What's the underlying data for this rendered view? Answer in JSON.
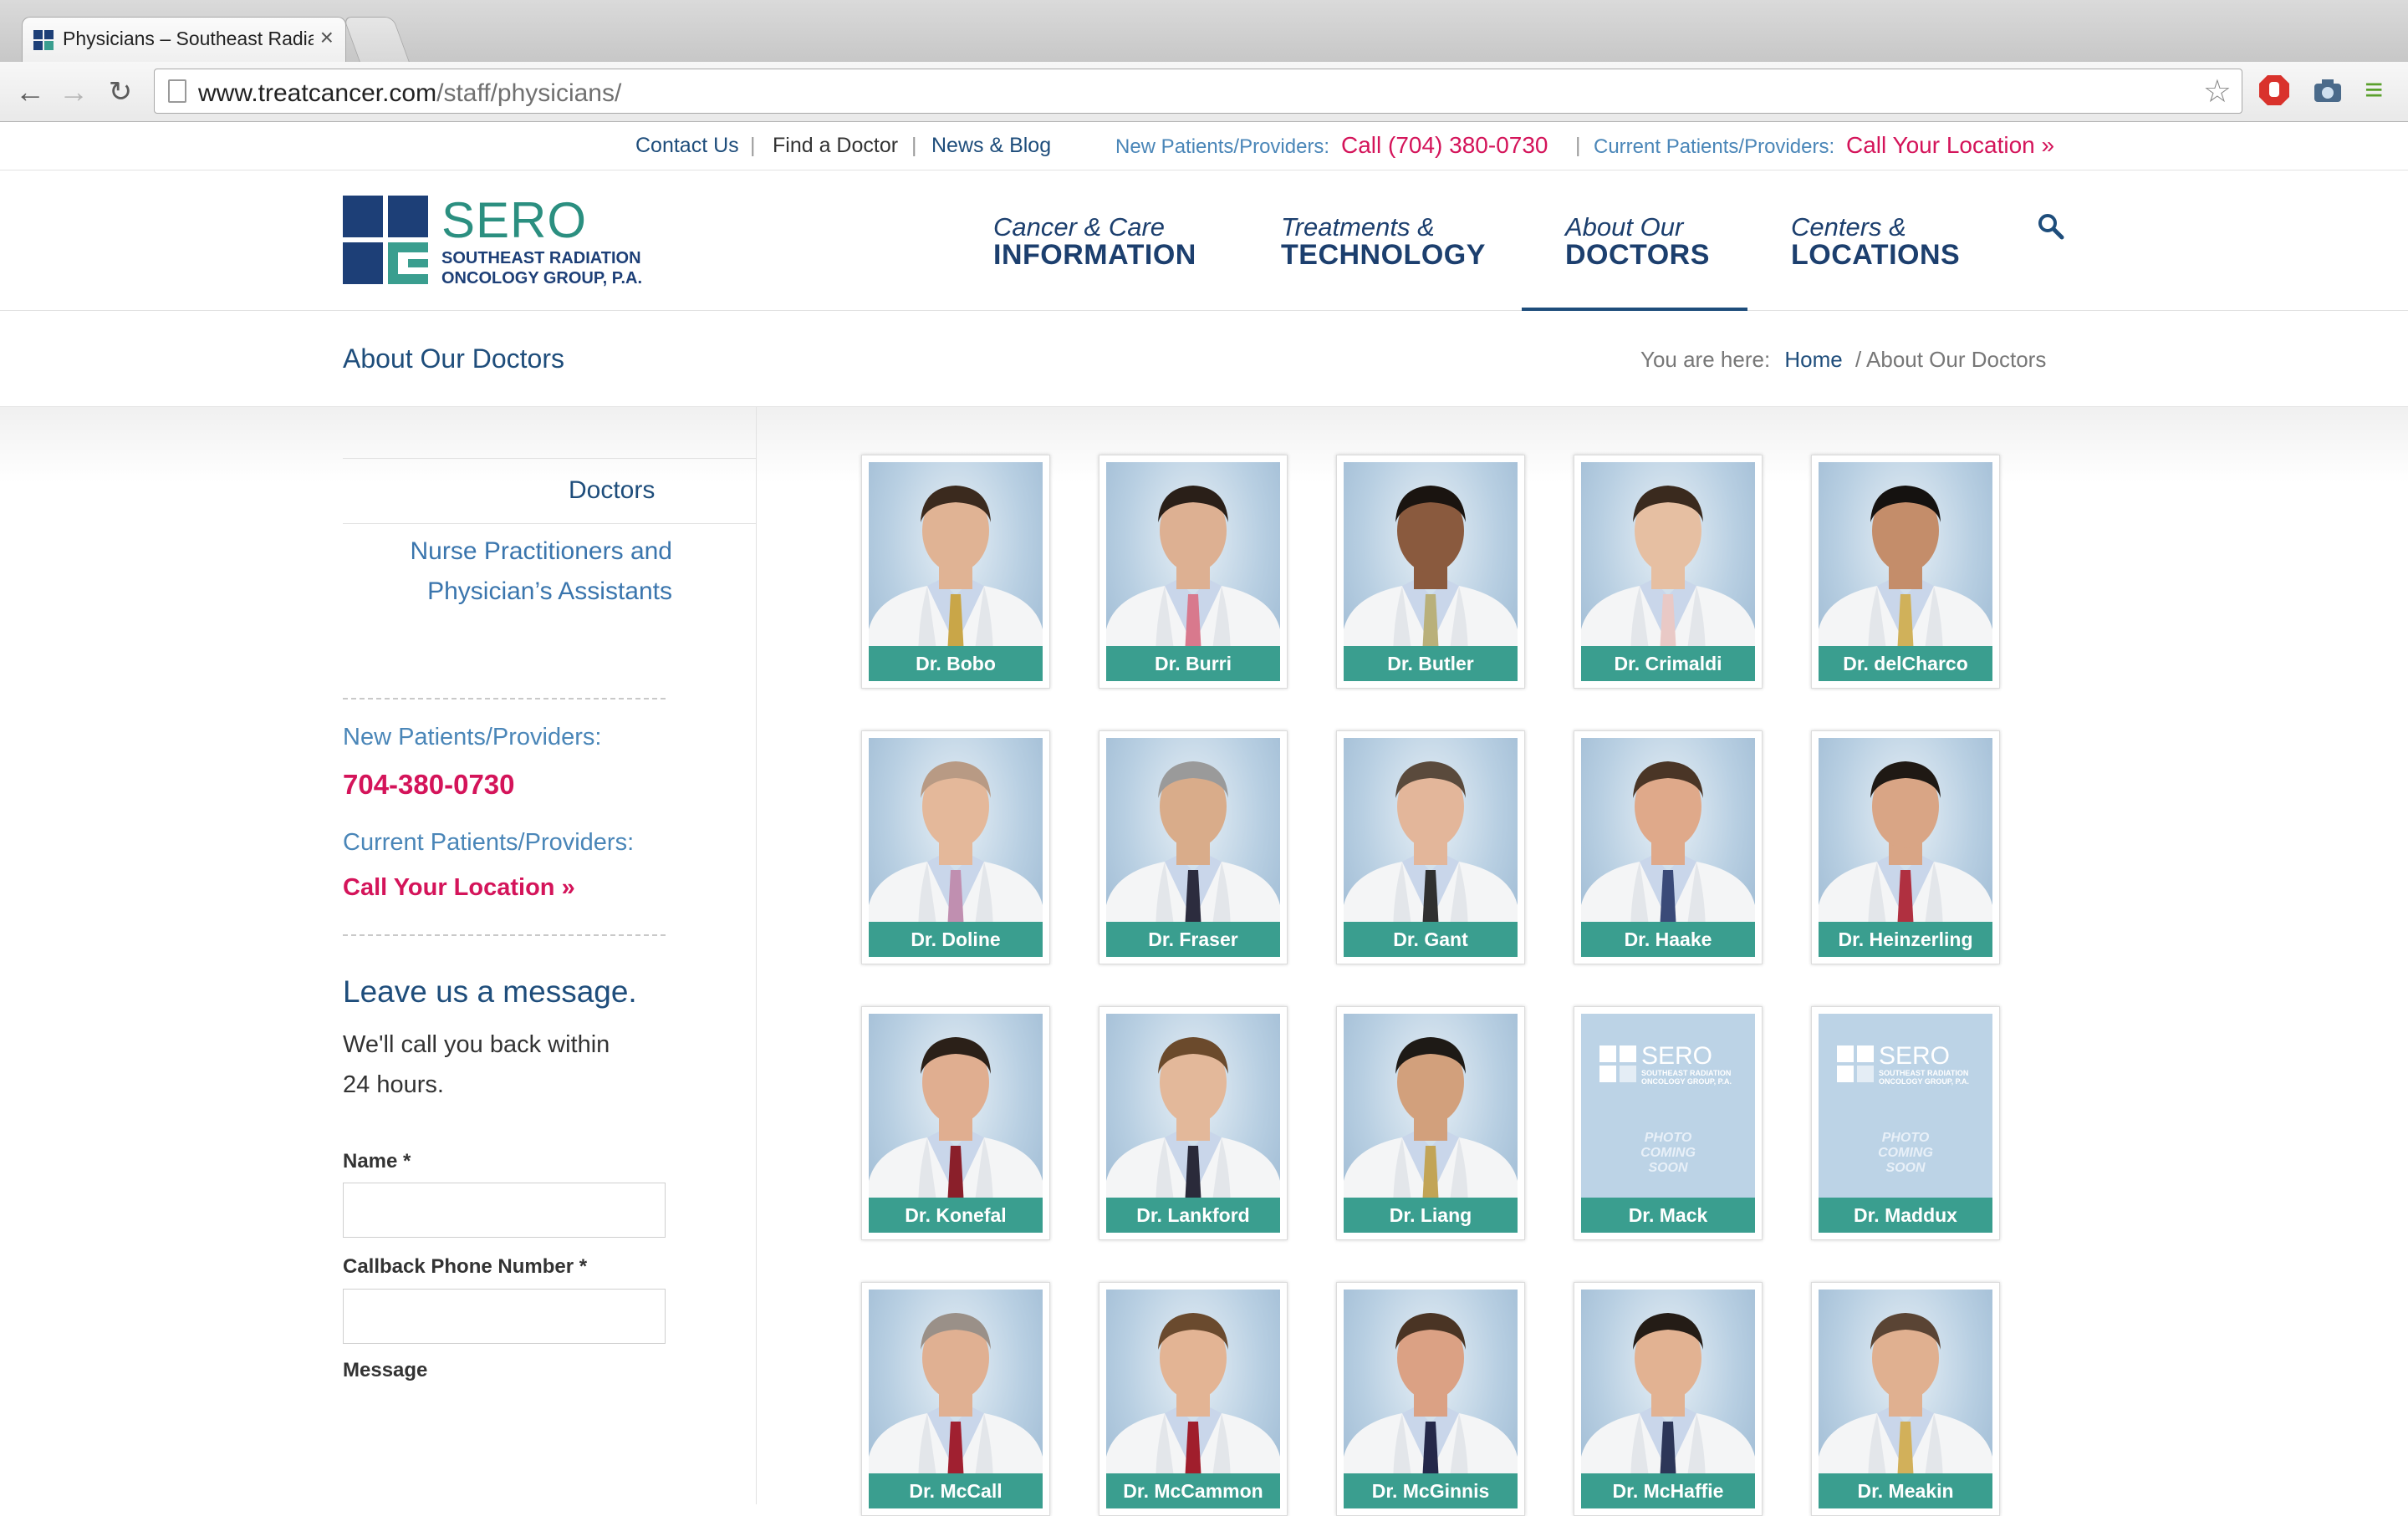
{
  "browser": {
    "tab_title": "Physicians – Southeast Radiation Oncology Group, P.A.",
    "url_host": "www.treatcancer.com",
    "url_path": "/staff/physicians/"
  },
  "utility": {
    "contact": "Contact Us",
    "find": "Find a Doctor",
    "news": "News & Blog",
    "new_label": "New Patients/Providers:",
    "new_call": "Call (704) 380-0730",
    "current_label": "Current Patients/Providers:",
    "current_call": "Call Your Location »"
  },
  "logo": {
    "name": "SERO",
    "line1": "SOUTHEAST RADIATION",
    "line2": "ONCOLOGY GROUP, P.A."
  },
  "menu": [
    {
      "l1": "Cancer & Care",
      "l2": "INFORMATION"
    },
    {
      "l1": "Treatments &",
      "l2": "TECHNOLOGY"
    },
    {
      "l1": "About Our",
      "l2": "DOCTORS"
    },
    {
      "l1": "Centers &",
      "l2": "LOCATIONS"
    }
  ],
  "titlebar": {
    "title": "About Our Doctors",
    "you_are_here": "You are here:",
    "home": "Home",
    "current": "/ About Our Doctors"
  },
  "sidebar": {
    "doctors": "Doctors",
    "np_line1": "Nurse Practitioners and",
    "np_line2": "Physician’s Assistants",
    "new_label": "New Patients/Providers:",
    "phone": "704-380-0730",
    "current_label": "Current Patients/Providers:",
    "call_location": "Call Your Location »",
    "form_title": "Leave us a message.",
    "form_sub1": "We'll call you back within",
    "form_sub2": "24 hours.",
    "name_label": "Name *",
    "phone_label": "Callback Phone Number *",
    "message_label": "Message"
  },
  "placeholder": {
    "brand": "SERO",
    "line1": "SOUTHEAST RADIATION",
    "line2": "ONCOLOGY GROUP, P.A.",
    "coming1": "PHOTO",
    "coming2": "COMING",
    "coming3": "SOON"
  },
  "doctors": [
    {
      "name": "Dr. Bobo",
      "hair": "#3b2a1e",
      "tie": "#c9a648",
      "skin": "#e0b394",
      "photo": true
    },
    {
      "name": "Dr. Burri",
      "hair": "#2a1f18",
      "tie": "#d8798d",
      "skin": "#ddb092",
      "photo": true
    },
    {
      "name": "Dr. Butler",
      "hair": "#1a1410",
      "tie": "#b9b07a",
      "skin": "#8a5a3e",
      "photo": true
    },
    {
      "name": "Dr. Crimaldi",
      "hair": "#3a2a1e",
      "tie": "#e9c9c6",
      "skin": "#e6bfa2",
      "photo": true
    },
    {
      "name": "Dr. delCharco",
      "hair": "#151210",
      "tie": "#d0b15a",
      "skin": "#c48d6a",
      "photo": true
    },
    {
      "name": "Dr. Doline",
      "hair": "#b89a84",
      "tie": "#c08fb0",
      "skin": "#e4b89a",
      "photo": true
    },
    {
      "name": "Dr. Fraser",
      "hair": "#9a9a9a",
      "tie": "#2c2c3e",
      "skin": "#d9ac8a",
      "photo": true
    },
    {
      "name": "Dr. Gant",
      "hair": "#5a4a3c",
      "tie": "#303030",
      "skin": "#e3b69a",
      "photo": true
    },
    {
      "name": "Dr. Haake",
      "hair": "#4a3526",
      "tie": "#3a4a78",
      "skin": "#dfa98a",
      "photo": true
    },
    {
      "name": "Dr. Heinzerling",
      "hair": "#1f1914",
      "tie": "#b03040",
      "skin": "#d9a585",
      "photo": true
    },
    {
      "name": "Dr. Konefal",
      "hair": "#2b2018",
      "tie": "#8a1f2a",
      "skin": "#e0ae90",
      "photo": true
    },
    {
      "name": "Dr. Lankford",
      "hair": "#6b4a2c",
      "tie": "#2a2a3a",
      "skin": "#e3b89a",
      "photo": true
    },
    {
      "name": "Dr. Liang",
      "hair": "#1e1a16",
      "tie": "#c2a456",
      "skin": "#d2a07c",
      "photo": true
    },
    {
      "name": "Dr. Mack",
      "photo": false
    },
    {
      "name": "Dr. Maddux",
      "photo": false
    },
    {
      "name": "Dr. McCall",
      "hair": "#9a9088",
      "tie": "#a02030",
      "skin": "#e0b092",
      "photo": true
    },
    {
      "name": "Dr. McCammon",
      "hair": "#6a4a2e",
      "tie": "#a01e2c",
      "skin": "#e3b494",
      "photo": true
    },
    {
      "name": "Dr. McGinnis",
      "hair": "#4a3424",
      "tie": "#24284a",
      "skin": "#dba184",
      "photo": true
    },
    {
      "name": "Dr. McHaffie",
      "hair": "#241c16",
      "tie": "#2c3658",
      "skin": "#e2b292",
      "photo": true
    },
    {
      "name": "Dr. Meakin",
      "hair": "#5a4434",
      "tie": "#d2b05a",
      "skin": "#e0b090",
      "photo": true
    }
  ]
}
